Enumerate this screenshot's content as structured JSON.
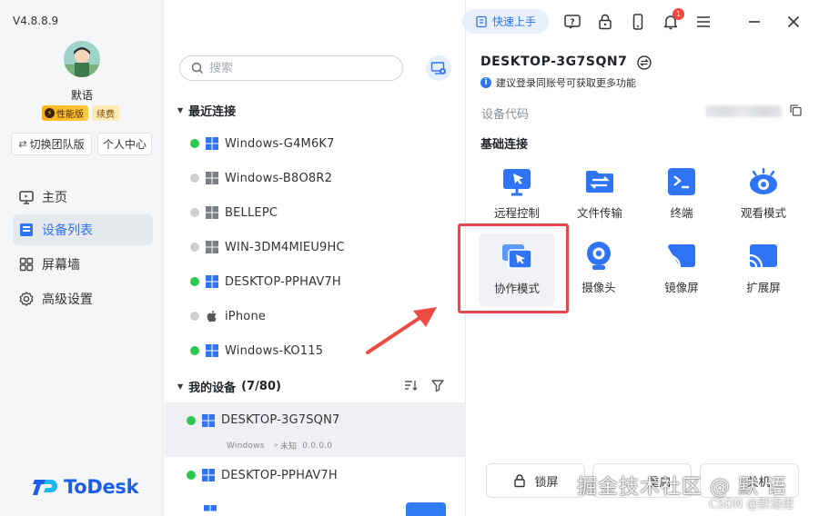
{
  "app": {
    "version": "V4.8.8.9",
    "logo_text": "ToDesk"
  },
  "user": {
    "name": "默语",
    "badge_perf": "性能版",
    "badge_renew": "续费"
  },
  "sidebar": {
    "team_button": "切换团队版",
    "personal_button": "个人中心",
    "items": [
      {
        "label": "主页",
        "icon": "monitor-icon"
      },
      {
        "label": "设备列表",
        "icon": "device-list-icon"
      },
      {
        "label": "屏幕墙",
        "icon": "grid-icon"
      },
      {
        "label": "高级设置",
        "icon": "gear-icon"
      }
    ],
    "active_index": 1
  },
  "search": {
    "placeholder": "搜索"
  },
  "recent": {
    "title": "最近连接",
    "devices": [
      {
        "name": "Windows-G4M6K7",
        "online": true,
        "os": "windows"
      },
      {
        "name": "Windows-B8O8R2",
        "online": false,
        "os": "windows"
      },
      {
        "name": "BELLEPC",
        "online": false,
        "os": "windows"
      },
      {
        "name": "WIN-3DM4MIEU9HC",
        "online": false,
        "os": "windows"
      },
      {
        "name": "DESKTOP-PPHAV7H",
        "online": true,
        "os": "windows"
      },
      {
        "name": "iPhone",
        "online": false,
        "os": "apple"
      },
      {
        "name": "Windows-KO115",
        "online": true,
        "os": "windows"
      }
    ]
  },
  "mine": {
    "title": "我的设备",
    "count": "(7/80)",
    "devices": [
      {
        "name": "DESKTOP-3G7SQN7",
        "online": true,
        "os": "windows",
        "sub_os": "Windows",
        "sub_loc": "未知",
        "sub_ip": "0.0.0.0"
      },
      {
        "name": "DESKTOP-PPHAV7H",
        "online": true,
        "os": "windows"
      }
    ]
  },
  "topbar": {
    "quick_start": "快速上手",
    "notif_count": "1"
  },
  "detail": {
    "device_name": "DESKTOP-3G7SQN7",
    "notice": "建议登录同账号可获取更多功能",
    "code_label": "设备代码",
    "basic_title": "基础连接",
    "features": [
      {
        "label": "远程控制",
        "icon": "remote-control-icon"
      },
      {
        "label": "文件传输",
        "icon": "file-transfer-icon"
      },
      {
        "label": "终端",
        "icon": "terminal-icon"
      },
      {
        "label": "观看模式",
        "icon": "eye-icon"
      },
      {
        "label": "协作模式",
        "icon": "collab-icon"
      },
      {
        "label": "摄像头",
        "icon": "camera-icon"
      },
      {
        "label": "镜像屏",
        "icon": "mirror-icon"
      },
      {
        "label": "扩展屏",
        "icon": "extend-icon"
      }
    ],
    "bottom": {
      "lock": "锁屏",
      "b2": "重启",
      "b3": "关机"
    }
  },
  "overlay": {
    "watermark": "掘金技术社区 @ 默 语",
    "csdn": "CSDN @默语佬"
  },
  "colors": {
    "accent": "#2f74f5",
    "online": "#2dc84d",
    "highlight": "#e8474a",
    "arrow": "#ee4b43"
  }
}
